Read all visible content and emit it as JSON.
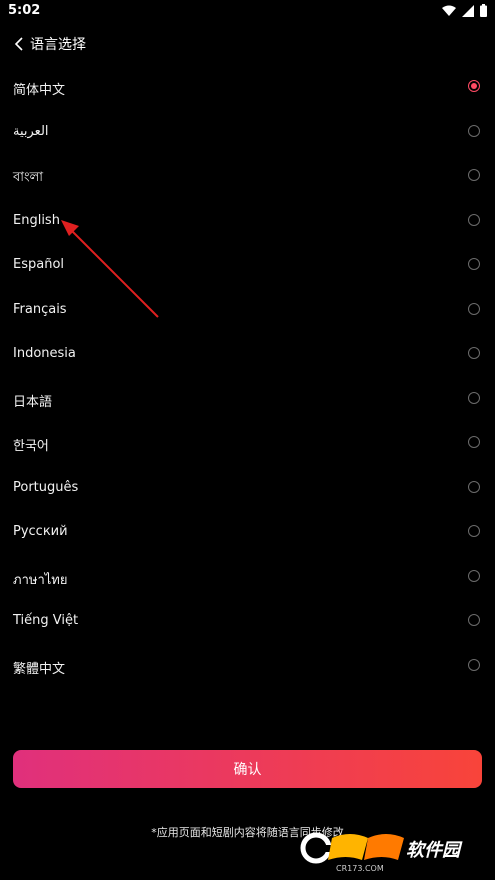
{
  "status": {
    "time": "5:02"
  },
  "header": {
    "title": "语言选择"
  },
  "languages": [
    {
      "label": "简体中文",
      "selected": true
    },
    {
      "label": "العربية",
      "selected": false
    },
    {
      "label": "বাংলা",
      "selected": false
    },
    {
      "label": "English",
      "selected": false
    },
    {
      "label": "Español",
      "selected": false
    },
    {
      "label": "Français",
      "selected": false
    },
    {
      "label": "Indonesia",
      "selected": false
    },
    {
      "label": "日本語",
      "selected": false
    },
    {
      "label": "한국어",
      "selected": false
    },
    {
      "label": "Português",
      "selected": false
    },
    {
      "label": "Русский",
      "selected": false
    },
    {
      "label": "ภาษาไทย",
      "selected": false
    },
    {
      "label": "Tiếng Việt",
      "selected": false
    },
    {
      "label": "繁體中文",
      "selected": false
    }
  ],
  "confirm_label": "确认",
  "note": "*应用页面和短剧内容将随语言同步修改",
  "watermark": {
    "text": "软件园",
    "url_text": "CR173.COM"
  },
  "colors": {
    "accent": "#ff4b64",
    "gradient_start": "#e0307c",
    "gradient_end": "#f8443a",
    "annotation_arrow": "#e02020"
  }
}
